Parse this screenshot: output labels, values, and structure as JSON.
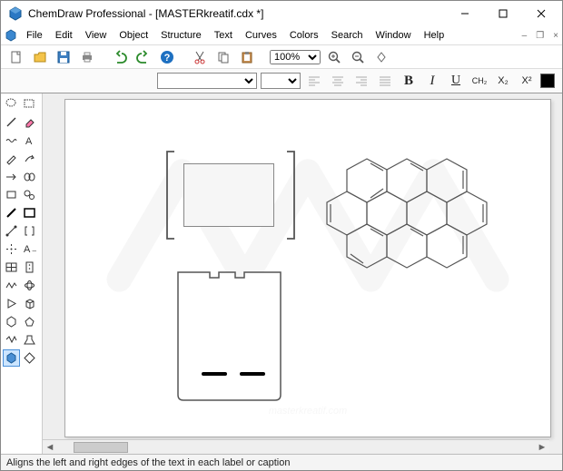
{
  "title": "ChemDraw Professional - [MASTERkreatif.cdx *]",
  "menu": {
    "file": "File",
    "edit": "Edit",
    "view": "View",
    "object": "Object",
    "structure": "Structure",
    "text": "Text",
    "curves": "Curves",
    "colors": "Colors",
    "search": "Search",
    "window": "Window",
    "help": "Help"
  },
  "toolbar": {
    "font": "",
    "size": "",
    "zoom": "100%"
  },
  "format": {
    "bold": "B",
    "italic": "I",
    "underline": "U",
    "ch2": "CH₂",
    "x2": "X₂",
    "xsup": "X²"
  },
  "status": "Aligns the left and right edges of the text in each label or caption",
  "watermark": "masterkreatif.com"
}
